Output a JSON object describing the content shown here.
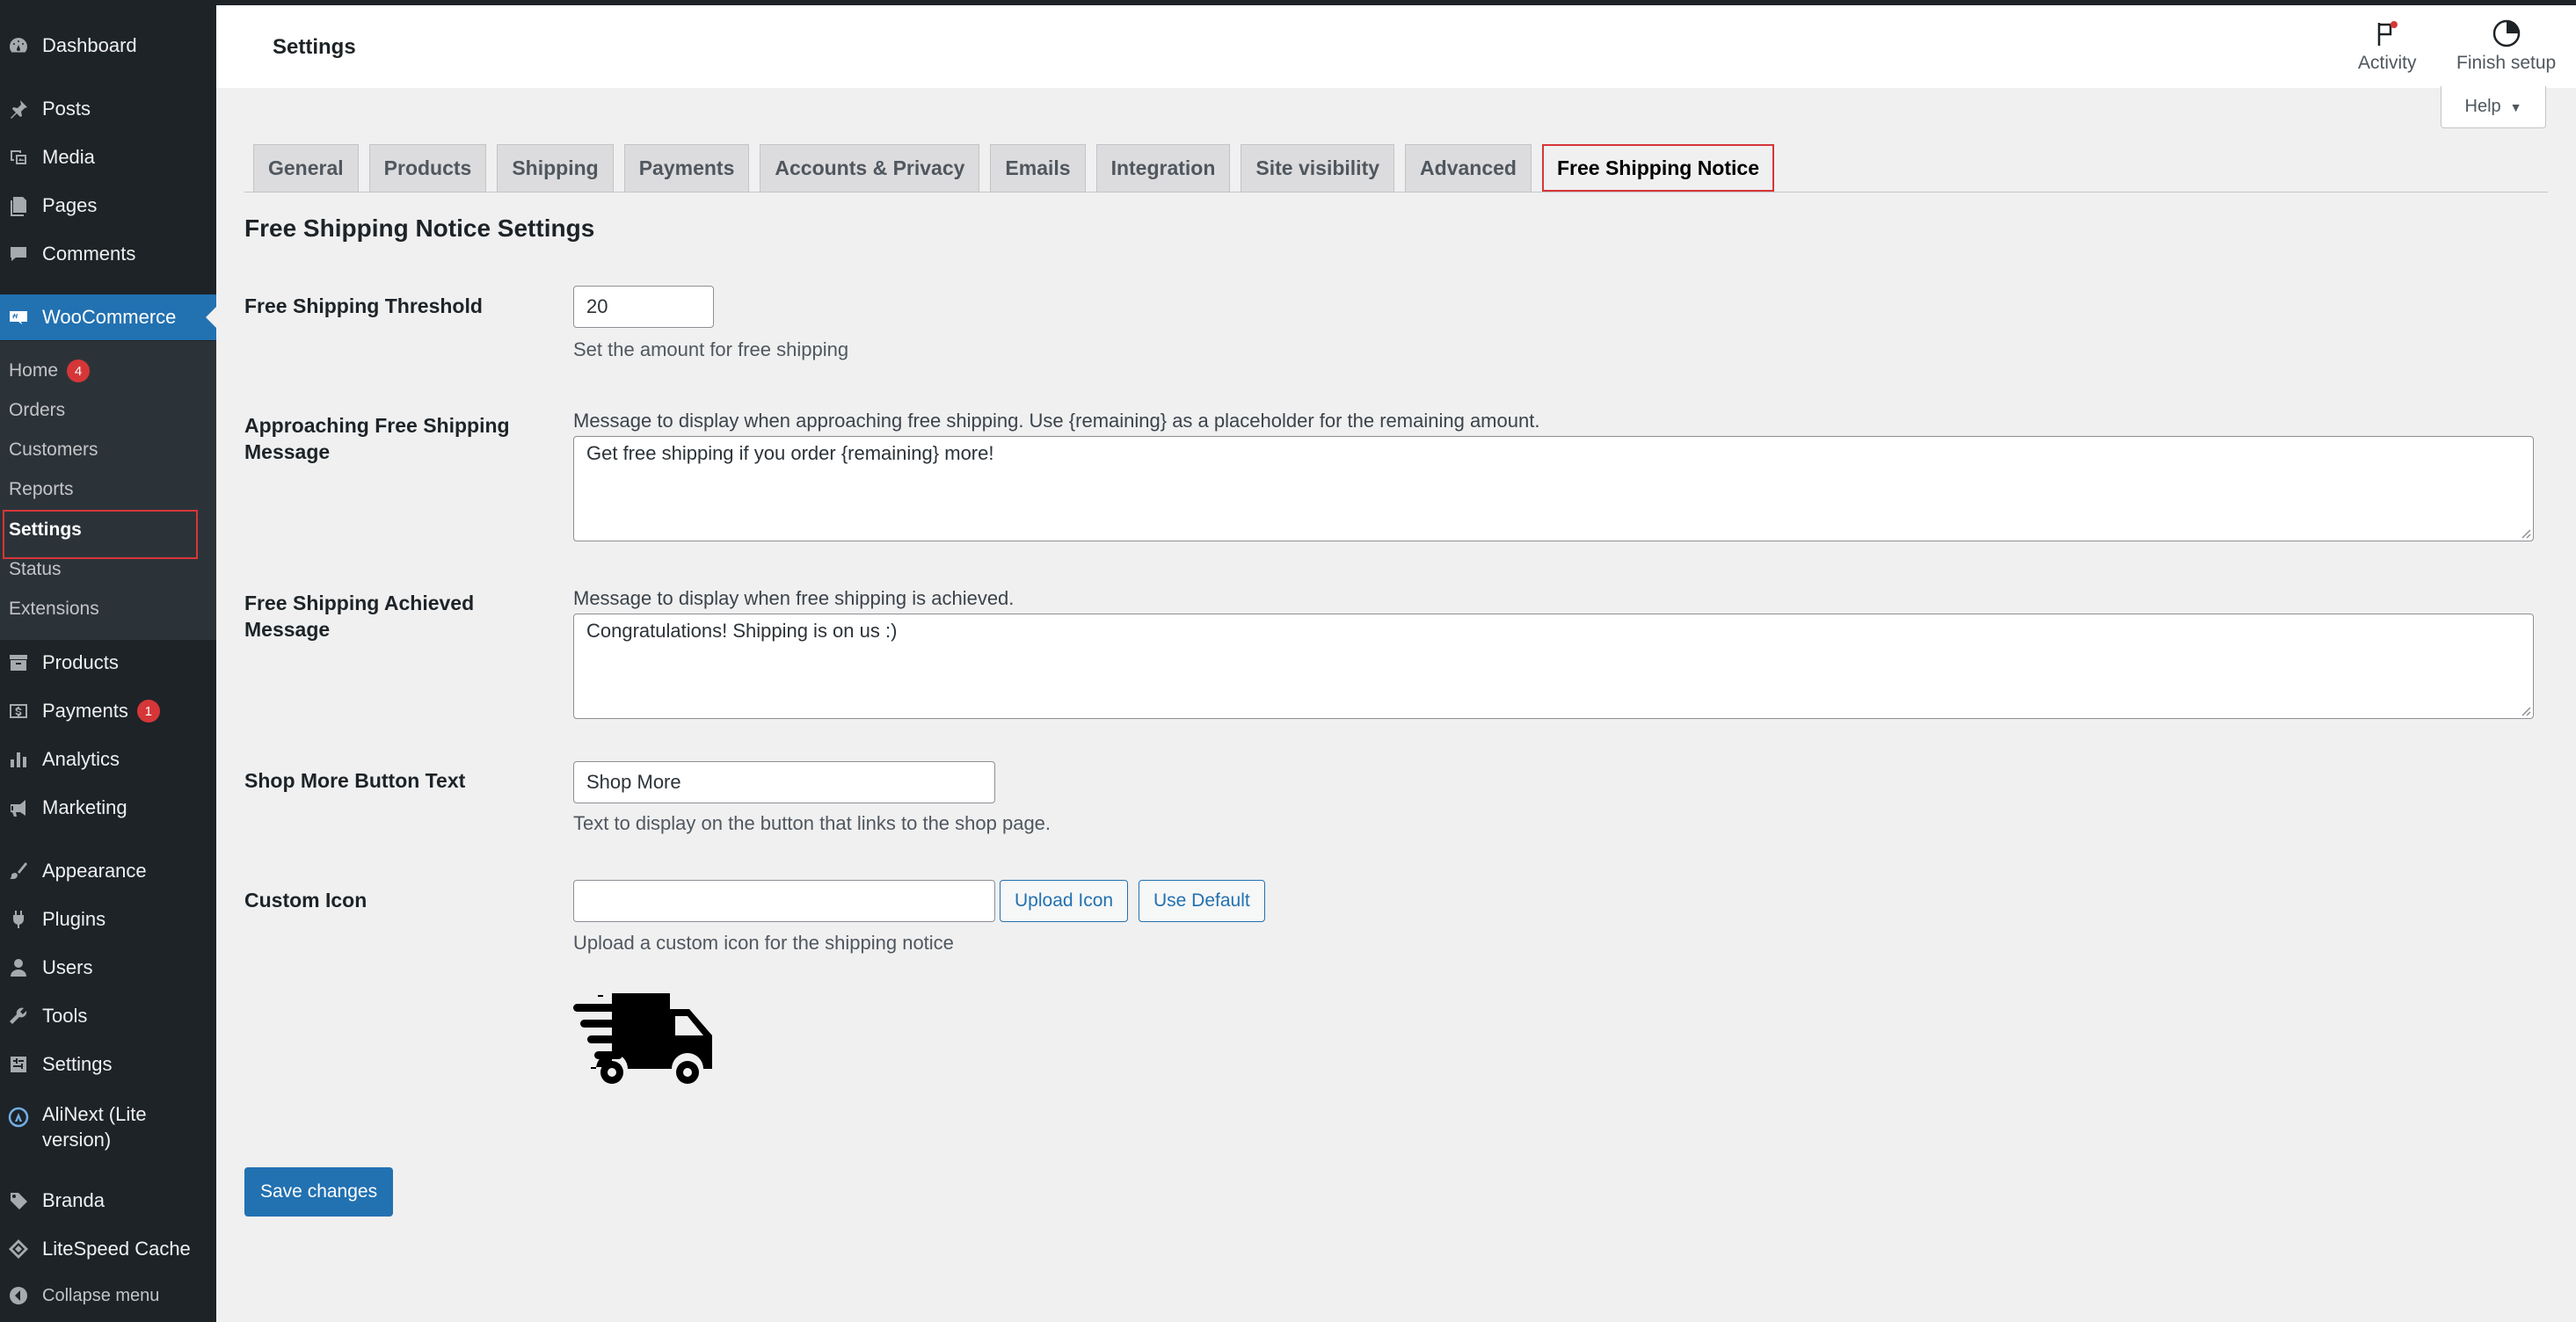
{
  "header": {
    "title": "Settings",
    "activity_label": "Activity",
    "finish_setup_label": "Finish setup"
  },
  "help": {
    "label": "Help"
  },
  "sidebar": {
    "items": [
      {
        "label": "Dashboard",
        "icon": "dashboard-icon"
      },
      {
        "label": "Posts",
        "icon": "pin-icon"
      },
      {
        "label": "Media",
        "icon": "media-icon"
      },
      {
        "label": "Pages",
        "icon": "pages-icon"
      },
      {
        "label": "Comments",
        "icon": "comment-icon"
      },
      {
        "label": "WooCommerce",
        "icon": "woo-icon"
      },
      {
        "label": "Products",
        "icon": "archive-icon"
      },
      {
        "label": "Payments",
        "icon": "dollar-icon",
        "badge": "1"
      },
      {
        "label": "Analytics",
        "icon": "bar-chart-icon"
      },
      {
        "label": "Marketing",
        "icon": "megaphone-icon"
      },
      {
        "label": "Appearance",
        "icon": "brush-icon"
      },
      {
        "label": "Plugins",
        "icon": "plug-icon"
      },
      {
        "label": "Users",
        "icon": "user-icon"
      },
      {
        "label": "Tools",
        "icon": "wrench-icon"
      },
      {
        "label": "Settings",
        "icon": "settings-icon"
      },
      {
        "label": "AliNext (Lite version)",
        "icon": "alinext-icon"
      },
      {
        "label": "Branda",
        "icon": "tag-icon"
      },
      {
        "label": "LiteSpeed Cache",
        "icon": "diamond-icon"
      },
      {
        "label": "Collapse menu",
        "icon": "collapse-icon"
      }
    ],
    "submenu": [
      {
        "label": "Home",
        "badge": "4"
      },
      {
        "label": "Orders"
      },
      {
        "label": "Customers"
      },
      {
        "label": "Reports"
      },
      {
        "label": "Settings"
      },
      {
        "label": "Status"
      },
      {
        "label": "Extensions"
      }
    ]
  },
  "tabs": [
    "General",
    "Products",
    "Shipping",
    "Payments",
    "Accounts & Privacy",
    "Emails",
    "Integration",
    "Site visibility",
    "Advanced",
    "Free Shipping Notice"
  ],
  "form": {
    "section_title": "Free Shipping Notice Settings",
    "threshold": {
      "label": "Free Shipping Threshold",
      "value": "20",
      "desc": "Set the amount for free shipping"
    },
    "approaching": {
      "label": "Approaching Free Shipping Message",
      "desc": "Message to display when approaching free shipping. Use {remaining} as a placeholder for the remaining amount.",
      "value": "Get free shipping if you order {remaining} more!"
    },
    "achieved": {
      "label": "Free Shipping Achieved Message",
      "desc": "Message to display when free shipping is achieved.",
      "value": "Congratulations! Shipping is on us :)"
    },
    "shop_more": {
      "label": "Shop More Button Text",
      "value": "Shop More",
      "desc": "Text to display on the button that links to the shop page."
    },
    "custom_icon": {
      "label": "Custom Icon",
      "value": "",
      "upload_label": "Upload Icon",
      "default_label": "Use Default",
      "desc": "Upload a custom icon for the shipping notice",
      "preview_icon": "truck-icon"
    },
    "save_label": "Save changes"
  },
  "colors": {
    "accent": "#2271b1",
    "sidebar_bg": "#1d2327",
    "highlight": "#d63638"
  }
}
